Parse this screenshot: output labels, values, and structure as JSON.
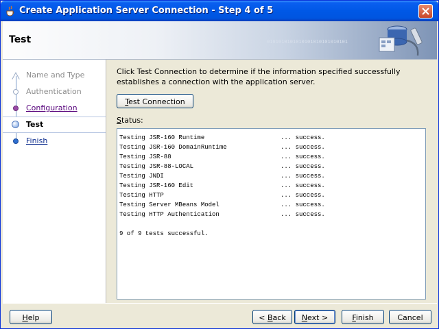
{
  "window": {
    "title": "Create Application Server Connection - Step 4 of 5"
  },
  "header": {
    "title": "Test",
    "binary_decoration": "0101010101010101010101010101"
  },
  "nav": {
    "items": [
      {
        "label": "Name and Type",
        "state": "disabled"
      },
      {
        "label": "Authentication",
        "state": "disabled"
      },
      {
        "label": "Configuration",
        "state": "link"
      },
      {
        "label": "Test",
        "state": "current"
      },
      {
        "label": "Finish",
        "state": "link"
      }
    ]
  },
  "content": {
    "description": "Click Test Connection to determine if the information specified successfully establishes a connection with the application server.",
    "test_button": {
      "label": "Test Connection",
      "mnemonic": "T",
      "rest": "est Connection"
    },
    "status_label": {
      "label": "Status:",
      "mnemonic": "S",
      "rest": "tatus:"
    },
    "status_lines": [
      {
        "test": "Testing JSR-160 Runtime",
        "result": "... success."
      },
      {
        "test": "Testing JSR-160 DomainRuntime",
        "result": "... success."
      },
      {
        "test": "Testing JSR-88",
        "result": "... success."
      },
      {
        "test": "Testing JSR-88-LOCAL",
        "result": "... success."
      },
      {
        "test": "Testing JNDI",
        "result": "... success."
      },
      {
        "test": "Testing JSR-160 Edit",
        "result": "... success."
      },
      {
        "test": "Testing HTTP",
        "result": "... success."
      },
      {
        "test": "Testing Server MBeans Model",
        "result": "... success."
      },
      {
        "test": "Testing HTTP Authentication",
        "result": "... success."
      }
    ],
    "summary": "9 of 9 tests successful."
  },
  "footer": {
    "help": {
      "label": "Help",
      "mnemonic": "H",
      "rest": "elp"
    },
    "back": {
      "label": "< Back",
      "pre": "< ",
      "mnemonic": "B",
      "rest": "ack"
    },
    "next": {
      "label": "Next >",
      "mnemonic": "N",
      "rest": "ext >"
    },
    "finish": {
      "label": "Finish",
      "mnemonic": "F",
      "rest": "inish"
    },
    "cancel": {
      "label": "Cancel"
    }
  },
  "colors": {
    "titlebar": "#0058e6",
    "nav_link_visited": "#55007a",
    "nav_link": "#0a2a8c",
    "button_border": "#003c74"
  }
}
